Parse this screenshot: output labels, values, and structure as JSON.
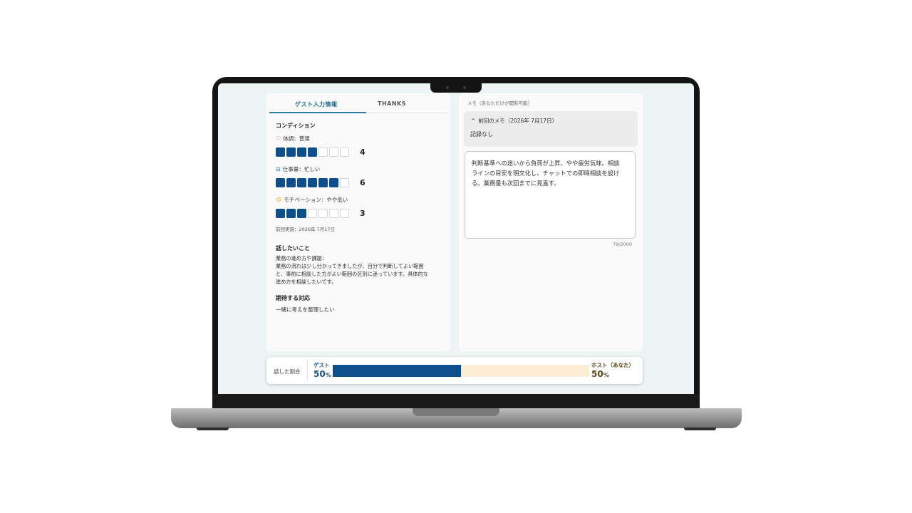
{
  "tabs": {
    "guest_info": "ゲスト入力情報",
    "thanks": "THANKS"
  },
  "condition": {
    "heading": "コンディション",
    "items": [
      {
        "icon": "heart-icon",
        "label": "体調：普通",
        "score": "4",
        "level": 4,
        "max": 7
      },
      {
        "icon": "briefcase-icon",
        "label": "仕事量：忙しい",
        "score": "6",
        "level": 6,
        "max": 7
      },
      {
        "icon": "face-icon",
        "label": "モチベーション：やや低い",
        "score": "3",
        "level": 3,
        "max": 7
      }
    ],
    "last_date": "前回実施：2026年 7月17日"
  },
  "topics": {
    "heading": "話したいこと",
    "subheading": "業務の進め方や課題：",
    "lines": [
      "業務の流れは少し分かってきましたが、自分で判断してよい範囲",
      "と、事前に相談した方がよい範囲の区別に迷っています。具体的な",
      "進め方を相談したいです。"
    ]
  },
  "expectation": {
    "heading": "期待する対応",
    "body": "一緒に考えを整理したい"
  },
  "memo": {
    "hint": "メモ（あなただけが閲覧可能）",
    "previous_title": "前回のメモ（2026年 7月17日）",
    "previous_body": "記録なし",
    "lines": [
      "判断基準への迷いから負荷が上昇。やや疲労気味。相談",
      "ラインの目安を明文化し、チャットでの即時相談を設け",
      "る。業務量も次回までに見直す。"
    ],
    "counter": "79/2000"
  },
  "talk_ratio": {
    "label": "話した割合",
    "guest_name": "ゲスト",
    "guest_value": "50",
    "host_name": "ホスト（あなた）",
    "host_value": "50",
    "percent_sign": "%",
    "guest_fraction": 0.5
  },
  "colors": {
    "accent": "#0d4f8c",
    "tab_active": "#1f6f93",
    "host_bar": "#fbeed4"
  }
}
